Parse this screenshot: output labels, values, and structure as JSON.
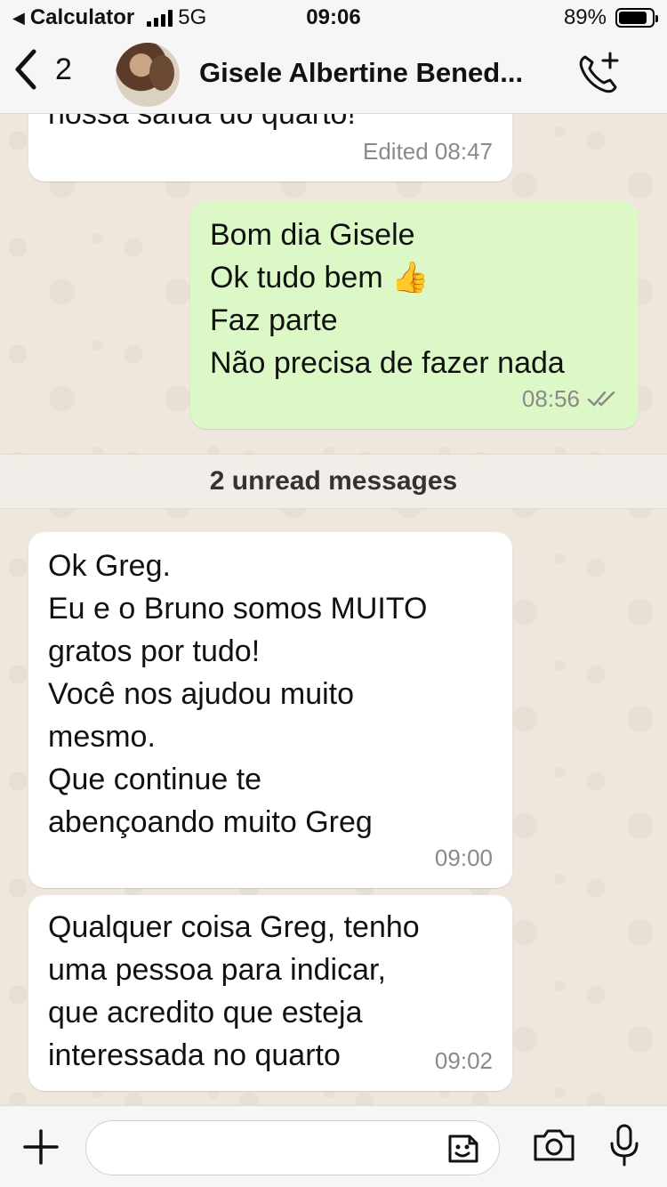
{
  "status_bar": {
    "back_app": "Calculator",
    "network": "5G",
    "time": "09:06",
    "battery": "89%"
  },
  "header": {
    "back_count": "2",
    "contact_name": "Gisele Albertine Bened..."
  },
  "messages": [
    {
      "direction": "incoming",
      "lines": [
        "nossa saída do quarto!"
      ],
      "meta": "Edited 08:47"
    },
    {
      "direction": "outgoing",
      "lines": [
        "Bom dia Gisele",
        "Ok tudo bem 👍",
        "Faz parte",
        "Não precisa de fazer nada"
      ],
      "meta": "08:56",
      "status_icon": "double-check-icon"
    },
    {
      "direction": "incoming",
      "lines": [
        "Ok Greg.",
        "Eu e o Bruno somos MUITO",
        "gratos por tudo!",
        "Você nos ajudou muito",
        "mesmo.",
        "Que continue te",
        "abençoando muito Greg"
      ],
      "meta": "09:00"
    },
    {
      "direction": "incoming",
      "lines": [
        "Qualquer coisa Greg, tenho",
        "uma pessoa para indicar,",
        "que acredito que esteja",
        "interessada no quarto"
      ],
      "meta": "09:02"
    }
  ],
  "unread_banner": "2 unread messages",
  "input": {
    "placeholder": ""
  },
  "colors": {
    "outgoing_bubble": "#DCF8C6",
    "incoming_bubble": "#FFFFFF",
    "chat_background": "#EFE7DE"
  }
}
